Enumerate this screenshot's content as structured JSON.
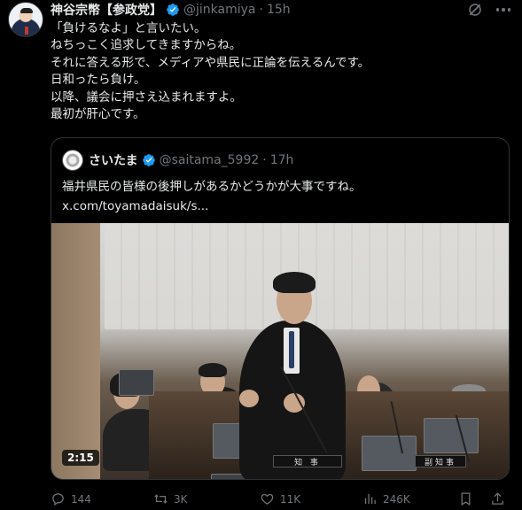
{
  "tweet": {
    "author_name": "神谷宗幣【参政党】",
    "handle": "@jinkamiya",
    "separator": "·",
    "time": "15h",
    "text": "「負けるなよ」と言いたい。\nねちっこく追求してきますからね。\nそれに答える形で、メディアや県民に正論を伝えるんです。\n日和ったら負け。\n以降、議会に押さえ込まれますよ。\n最初が肝心です。"
  },
  "quote": {
    "author_name": "さいたま",
    "handle": "@saitama_5992",
    "separator": "·",
    "time": "17h",
    "text": "福井県民の皆様の後押しがあるかどうかが大事ですね。",
    "link": "x.com/toyamadaisuk/s...",
    "video_duration": "2:15",
    "nameplate_left": "知 事",
    "nameplate_right": "副知事"
  },
  "actions": {
    "replies": "144",
    "reposts": "3K",
    "likes": "11K",
    "views": "246K"
  },
  "colors": {
    "background": "#000000",
    "text": "#e7e9ea",
    "muted": "#71767b",
    "verified": "#1d9bf0",
    "border": "#2f3336"
  }
}
